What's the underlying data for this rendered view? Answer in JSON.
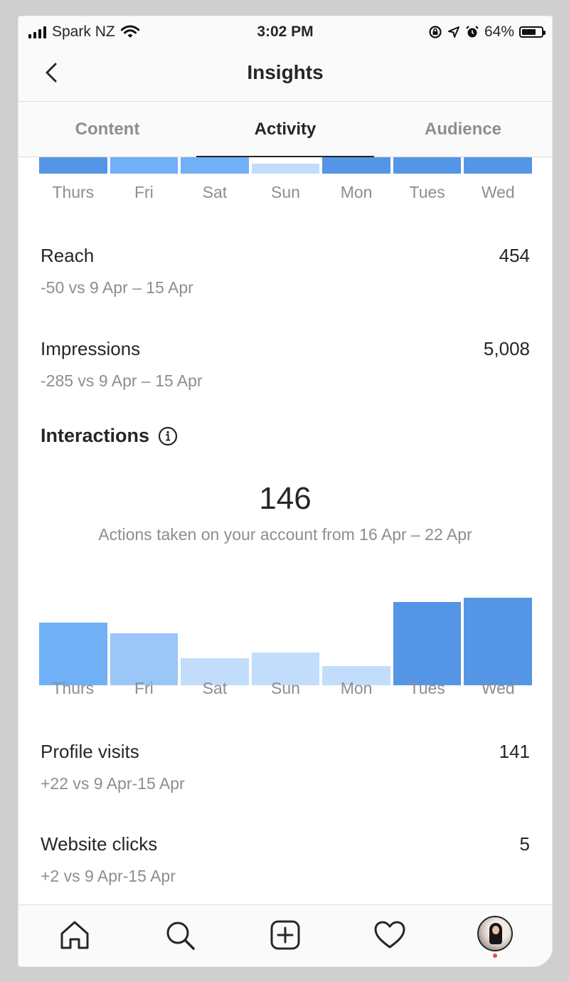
{
  "status_bar": {
    "carrier": "Spark NZ",
    "time": "3:02 PM",
    "battery": "64%",
    "battery_level": 0.64
  },
  "header": {
    "title": "Insights"
  },
  "tabs": [
    {
      "label": "Content",
      "active": false
    },
    {
      "label": "Activity",
      "active": true
    },
    {
      "label": "Audience",
      "active": false
    }
  ],
  "discovery_chart": {
    "days": [
      "Thurs",
      "Fri",
      "Sat",
      "Sun",
      "Mon",
      "Tues",
      "Wed"
    ],
    "colors": [
      "#5595e6",
      "#6fb0f7",
      "#6fb0f7",
      "#c2ddfb",
      "#5595e6",
      "#5595e6",
      "#5595e6"
    ]
  },
  "metrics": {
    "reach": {
      "label": "Reach",
      "value": "454",
      "comparison": "-50 vs 9 Apr – 15 Apr"
    },
    "impressions": {
      "label": "Impressions",
      "value": "5,008",
      "comparison": "-285 vs 9 Apr – 15 Apr"
    }
  },
  "interactions": {
    "title": "Interactions",
    "total": "146",
    "caption": "Actions taken on your account from 16 Apr – 22 Apr",
    "profile_visits": {
      "label": "Profile visits",
      "value": "141",
      "comparison": "+22 vs 9 Apr-15 Apr"
    },
    "website_clicks": {
      "label": "Website clicks",
      "value": "5",
      "comparison": "+2 vs 9 Apr-15 Apr"
    }
  },
  "chart_data": {
    "type": "bar",
    "categories": [
      "Thurs",
      "Fri",
      "Sat",
      "Sun",
      "Mon",
      "Tues",
      "Wed"
    ],
    "values": [
      21,
      17.5,
      9,
      11,
      6.5,
      28,
      29.5
    ],
    "ylim": [
      0,
      30
    ],
    "colors": [
      "#6fb0f7",
      "#9ac6f8",
      "#c2ddfb",
      "#c2ddfb",
      "#c2ddfb",
      "#5595e6",
      "#5595e6"
    ],
    "grid": false,
    "xlabel": "",
    "ylabel": ""
  },
  "bottom_nav": [
    "home-icon",
    "search-icon",
    "add-post-icon",
    "activity-heart-icon",
    "profile-avatar"
  ]
}
